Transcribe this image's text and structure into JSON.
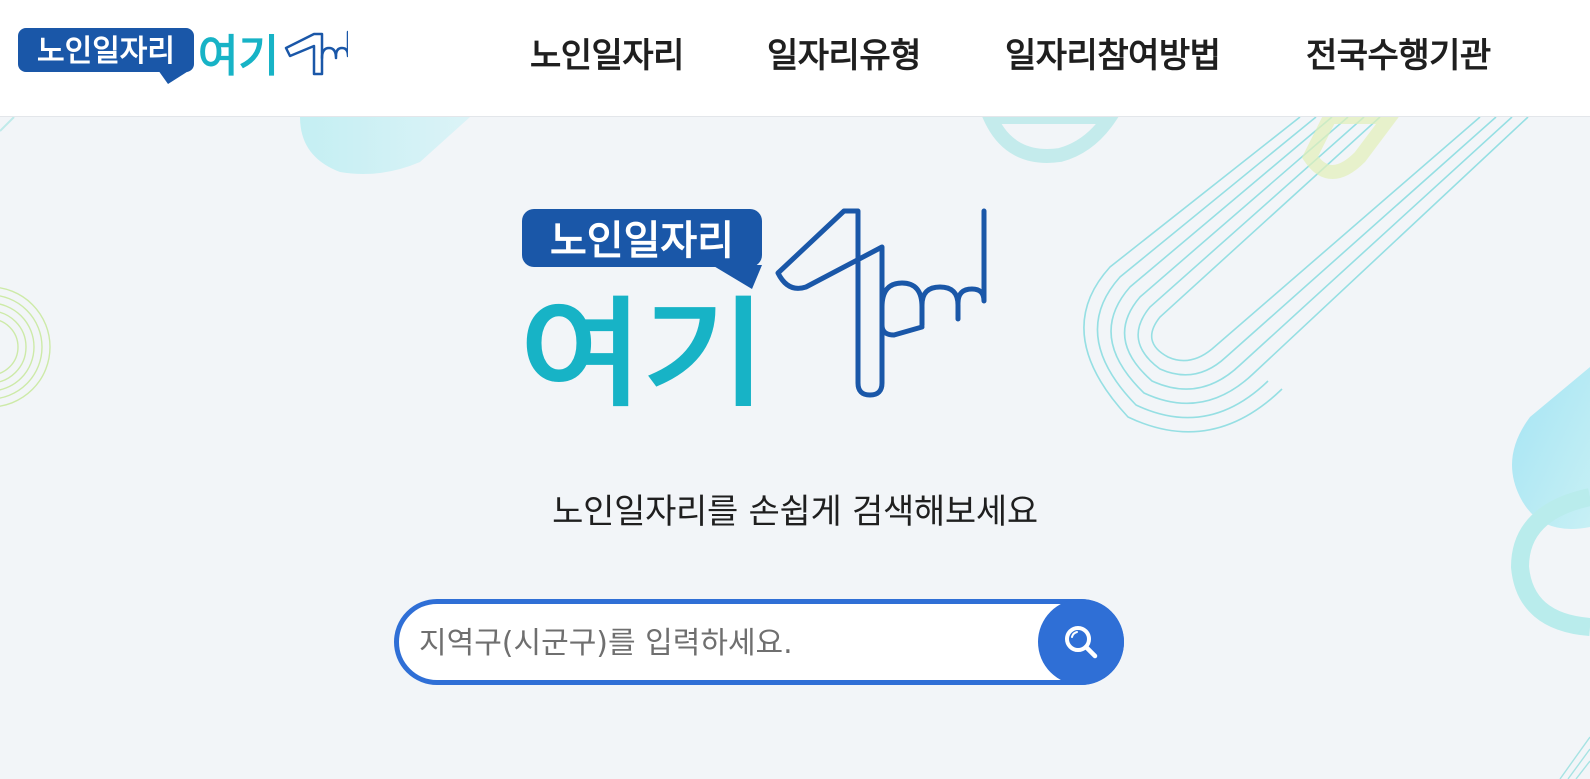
{
  "brand": {
    "badge_text": "노인일자리",
    "main_text": "여기",
    "badge_color": "#1a57a8",
    "main_color": "#17b3c6",
    "accent_color": "#1a57a8",
    "icon": "pointing-hand-icon"
  },
  "nav": {
    "items": [
      {
        "label": "노인일자리"
      },
      {
        "label": "일자리유형"
      },
      {
        "label": "일자리참여방법"
      },
      {
        "label": "전국수행기관"
      }
    ]
  },
  "hero": {
    "tagline": "노인일자리를 손쉽게 검색해보세요"
  },
  "search": {
    "placeholder": "지역구(시군구)를 입력하세요.",
    "value": "",
    "button_icon": "search-icon",
    "color": "#2f6fd6"
  }
}
